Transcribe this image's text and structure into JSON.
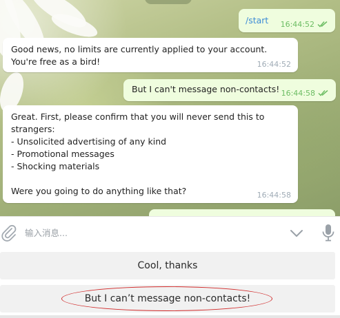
{
  "chat": {
    "messages": [
      {
        "direction": "out",
        "text": "/start",
        "time": "16:44:52",
        "read": true
      },
      {
        "direction": "in",
        "text": "Good news, no limits are currently applied to your account. You're free as a bird!",
        "time": "16:44:52"
      },
      {
        "direction": "out",
        "text": "But I can't message non-contacts!",
        "time": "16:44:58",
        "read": true
      },
      {
        "direction": "in",
        "text": "Great. First, please confirm that you will never send this to strangers:\n- Unsolicited advertising of any kind\n- Promotional messages\n- Shocking materials\n\nWere you going to do anything like that?",
        "time": "16:44:58"
      }
    ]
  },
  "composer": {
    "placeholder": "输入消息...",
    "icons": {
      "attach": "paperclip-icon",
      "scroll_down": "chevron-down-icon",
      "voice": "microphone-icon"
    }
  },
  "keyboard": {
    "buttons": [
      {
        "label": "Cool, thanks"
      },
      {
        "label": "But I can’t message non-contacts!",
        "highlighted": true
      }
    ]
  },
  "colors": {
    "outgoing_bubble": "#effdde",
    "incoming_bubble": "#ffffff",
    "read_checks": "#6cbd63",
    "command_link": "#3d8cd6",
    "highlight_ring": "#d12a2a"
  }
}
